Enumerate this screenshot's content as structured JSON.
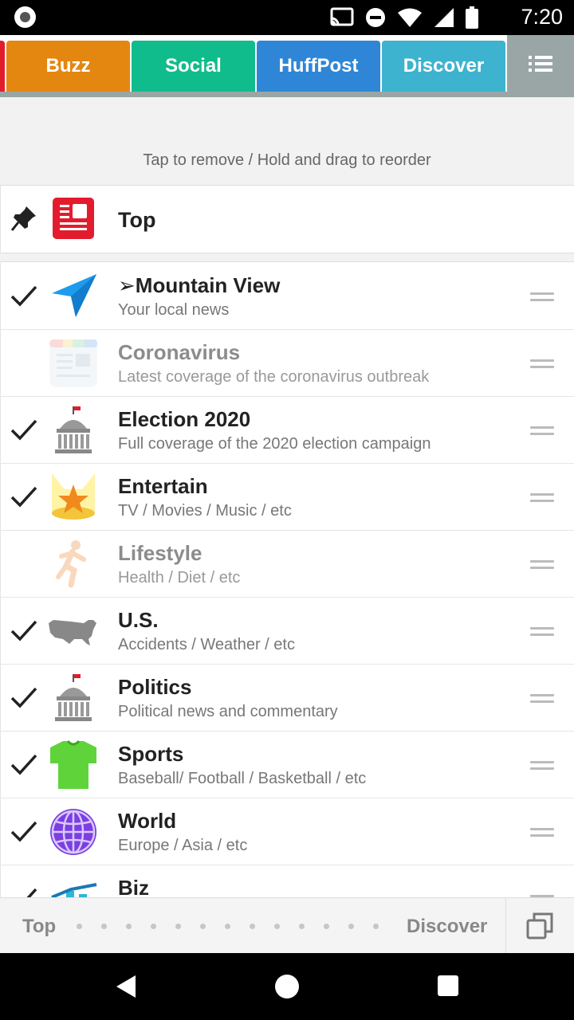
{
  "status_bar": {
    "time": "7:20"
  },
  "tabs": [
    {
      "label": "Buzz",
      "color": "#e38711"
    },
    {
      "label": "Social",
      "color": "#11bc8c"
    },
    {
      "label": "HuffPost",
      "color": "#2f86d6"
    },
    {
      "label": "Discover",
      "color": "#3db3cf"
    }
  ],
  "hint": "Tap to remove / Hold and drag to reorder",
  "pinned": {
    "label": "Top"
  },
  "categories": [
    {
      "title": "➢Mountain View",
      "subtitle": "Your local news",
      "checked": true,
      "icon": "location-arrow-icon"
    },
    {
      "title": "Coronavirus",
      "subtitle": "Latest coverage of the coronavirus outbreak",
      "checked": false,
      "icon": "news-card-icon"
    },
    {
      "title": "Election 2020",
      "subtitle": "Full coverage of the 2020 election campaign",
      "checked": true,
      "icon": "capitol-icon"
    },
    {
      "title": "Entertain",
      "subtitle": "TV / Movies / Music / etc",
      "checked": true,
      "icon": "star-spotlight-icon"
    },
    {
      "title": "Lifestyle",
      "subtitle": "Health / Diet / etc",
      "checked": false,
      "icon": "runner-icon"
    },
    {
      "title": "U.S.",
      "subtitle": "Accidents / Weather / etc",
      "checked": true,
      "icon": "usa-map-icon"
    },
    {
      "title": "Politics",
      "subtitle": "Political news and commentary",
      "checked": true,
      "icon": "capitol-icon"
    },
    {
      "title": "Sports",
      "subtitle": "Baseball/ Football / Basketball / etc",
      "checked": true,
      "icon": "jersey-icon"
    },
    {
      "title": "World",
      "subtitle": "Europe / Asia / etc",
      "checked": true,
      "icon": "globe-icon"
    },
    {
      "title": "Biz",
      "subtitle": "",
      "checked": true,
      "icon": "chart-icon"
    }
  ],
  "bottom_bar": {
    "left_label": "Top",
    "right_label": "Discover"
  },
  "colors": {
    "accent_red": "#e31c2d",
    "menu_gray": "#9aa6a6"
  }
}
